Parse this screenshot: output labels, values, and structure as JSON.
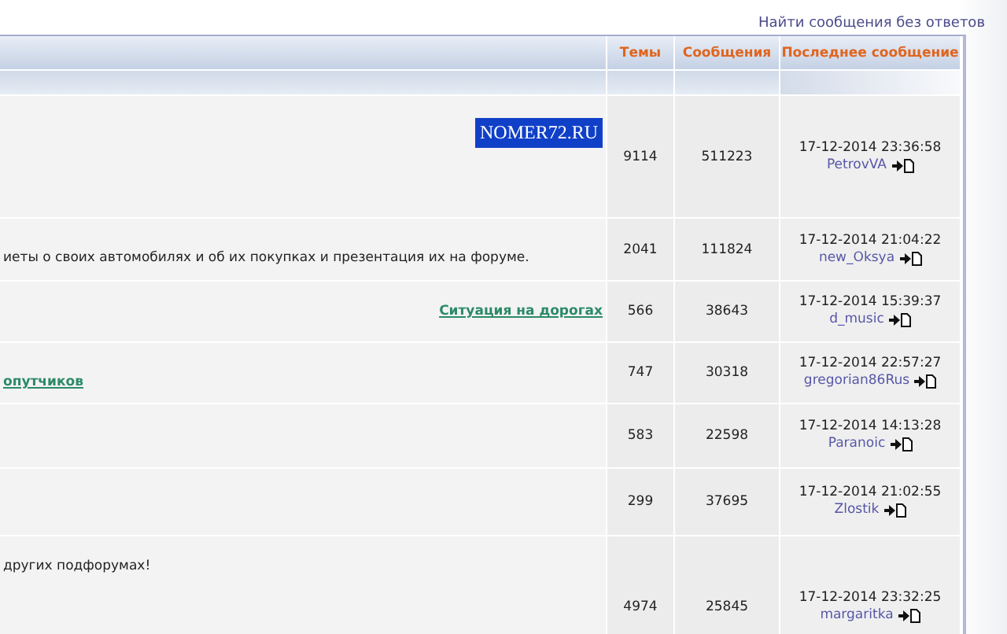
{
  "top_link": "Найти сообщения без ответов",
  "columns": [
    "Темы",
    "Сообщения",
    "Последнее сообщение"
  ],
  "rows": [
    {
      "kind": "banner",
      "text": "NOMER72.RU",
      "topics": "9114",
      "posts": "511223",
      "date": "17-12-2014 23:36:58",
      "user": "PetrovVA"
    },
    {
      "kind": "description",
      "text": "иеты о своих автомобилях и об их покупках и презентация их на форуме.",
      "topics": "2041",
      "posts": "111824",
      "date": "17-12-2014 21:04:22",
      "user": "new_Oksya"
    },
    {
      "kind": "subforum-right",
      "text": "Ситуация на дорогах",
      "topics": "566",
      "posts": "38643",
      "date": "17-12-2014 15:39:37",
      "user": "d_music"
    },
    {
      "kind": "subforum-left",
      "text": "опутчиков",
      "topics": "747",
      "posts": "30318",
      "date": "17-12-2014 22:57:27",
      "user": "gregorian86Rus"
    },
    {
      "kind": "empty",
      "topics": "583",
      "posts": "22598",
      "date": "17-12-2014 14:13:28",
      "user": "Paranoic"
    },
    {
      "kind": "empty",
      "topics": "299",
      "posts": "37695",
      "date": "17-12-2014 21:02:55",
      "user": "Zlostik"
    },
    {
      "kind": "description-top",
      "text": "других подфорумах!",
      "topics": "4974",
      "posts": "25845",
      "date": "17-12-2014 23:32:25",
      "user": "margaritka"
    }
  ]
}
